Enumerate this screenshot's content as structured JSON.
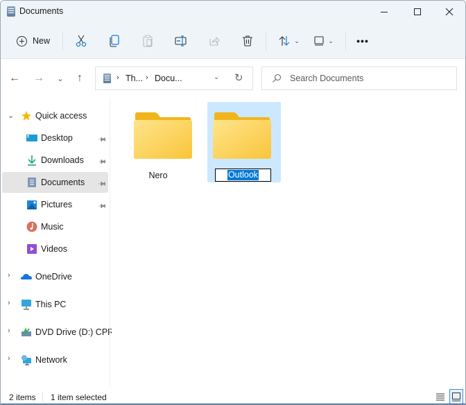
{
  "window": {
    "title": "Documents"
  },
  "toolbar": {
    "new_label": "New",
    "items": [
      {
        "name": "cut",
        "icon": "scissors-icon"
      },
      {
        "name": "copy",
        "icon": "copy-icon"
      },
      {
        "name": "paste",
        "icon": "paste-icon"
      },
      {
        "name": "rename",
        "icon": "rename-icon"
      },
      {
        "name": "share",
        "icon": "share-icon"
      },
      {
        "name": "delete",
        "icon": "trash-icon"
      },
      {
        "name": "sort",
        "icon": "sort-icon"
      },
      {
        "name": "view",
        "icon": "view-icon"
      },
      {
        "name": "more",
        "icon": "more-icon"
      }
    ],
    "more_label": "•••"
  },
  "navigation": {
    "back": "←",
    "forward": "→",
    "recent": "⌄",
    "up": "↑"
  },
  "address": {
    "crumbs": [
      "Th...",
      "Docu..."
    ],
    "separator": "›",
    "dropdown": "⌄",
    "refresh": "↻"
  },
  "search": {
    "placeholder": "Search Documents"
  },
  "sidebar": {
    "quick_access": {
      "label": "Quick access",
      "expanded": true,
      "items": [
        {
          "label": "Desktop",
          "icon": "desktop-icon",
          "pinned": true
        },
        {
          "label": "Downloads",
          "icon": "downloads-icon",
          "pinned": true
        },
        {
          "label": "Documents",
          "icon": "documents-icon",
          "pinned": true,
          "selected": true
        },
        {
          "label": "Pictures",
          "icon": "pictures-icon",
          "pinned": true
        },
        {
          "label": "Music",
          "icon": "music-icon",
          "pinned": false
        },
        {
          "label": "Videos",
          "icon": "videos-icon",
          "pinned": false
        }
      ]
    },
    "roots": [
      {
        "label": "OneDrive",
        "icon": "onedrive-icon"
      },
      {
        "label": "This PC",
        "icon": "this-pc-icon"
      },
      {
        "label": "DVD Drive (D:) CPRA",
        "icon": "dvd-drive-icon"
      },
      {
        "label": "Network",
        "icon": "network-icon"
      }
    ]
  },
  "content": {
    "items": [
      {
        "label": "Nero",
        "type": "folder",
        "selected": false
      },
      {
        "label": "Outlook",
        "type": "folder",
        "selected": true,
        "renaming": true
      }
    ]
  },
  "status": {
    "item_count": "2 items",
    "selection": "1 item selected"
  },
  "colors": {
    "accent": "#0078d7",
    "selection_bg": "#cce8ff",
    "toolbar_bg": "#eff4f9",
    "folder_yellow": "#ffd75e"
  }
}
